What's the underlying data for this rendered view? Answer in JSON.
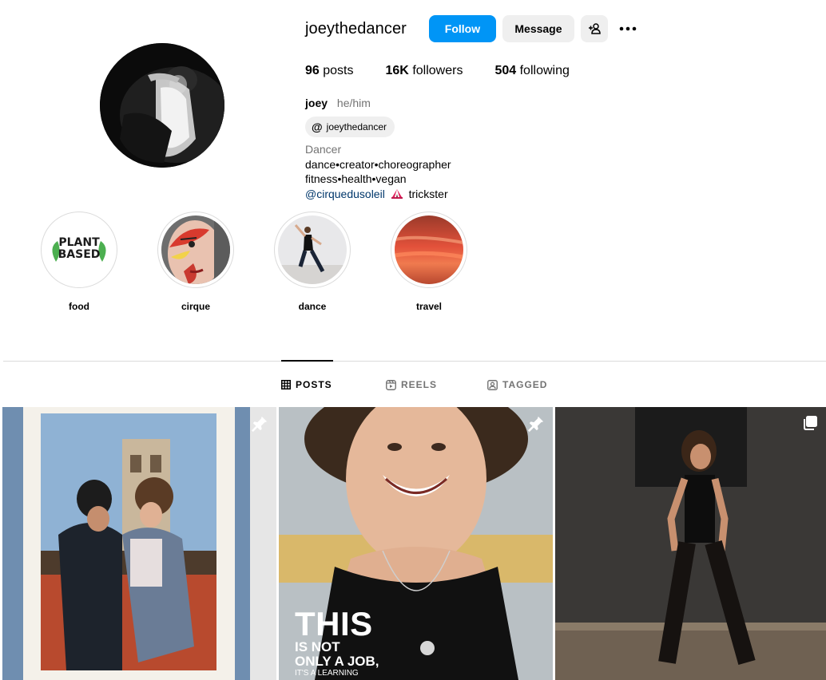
{
  "profile": {
    "username": "joeythedancer",
    "follow_label": "Follow",
    "message_label": "Message",
    "stats": {
      "posts_count": "96",
      "posts_label": "posts",
      "followers_count": "16K",
      "followers_label": "followers",
      "following_count": "504",
      "following_label": "following"
    },
    "full_name": "joey",
    "pronouns": "he/him",
    "threads_handle": "joeythedancer",
    "category": "Dancer",
    "bio_line1": "dance•creator•choreographer",
    "bio_line2": "fitness•health•vegan",
    "bio_mention": "@cirquedusoleil",
    "bio_mention_suffix": "trickster"
  },
  "highlights": [
    {
      "label": "food",
      "cover_text_1": "PLANT",
      "cover_text_2": "BASED"
    },
    {
      "label": "cirque"
    },
    {
      "label": "dance"
    },
    {
      "label": "travel"
    }
  ],
  "tabs": [
    {
      "label": "POSTS",
      "active": true
    },
    {
      "label": "REELS",
      "active": false
    },
    {
      "label": "TAGGED",
      "active": false
    }
  ],
  "posts": [
    {
      "pinned": true,
      "type": "image"
    },
    {
      "pinned": true,
      "type": "image",
      "overlay_big": "THIS",
      "overlay_line1": "IS NOT",
      "overlay_line2": "ONLY A JOB,",
      "overlay_line3": "IT'S A LEARNING"
    },
    {
      "pinned": false,
      "type": "carousel"
    }
  ],
  "colors": {
    "follow_button": "#0095f6",
    "secondary_button": "#efefef",
    "muted_text": "#737373",
    "link_text": "#00376b",
    "divider": "#dbdbdb"
  },
  "icons": {
    "add_user": "person-plus-icon",
    "more": "more-options-icon",
    "threads": "threads-icon",
    "posts_tab": "grid-icon",
    "reels_tab": "reels-icon",
    "tagged_tab": "tagged-icon",
    "pin": "pin-icon",
    "carousel": "carousel-icon"
  }
}
